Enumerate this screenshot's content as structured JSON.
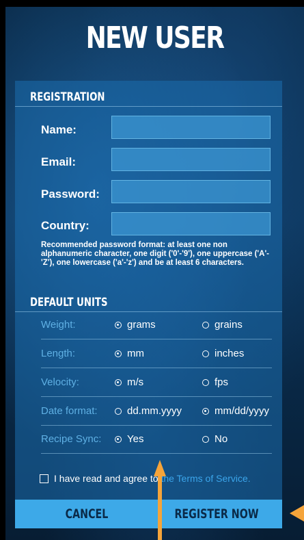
{
  "title": "NEW USER",
  "registration": {
    "heading": "REGISTRATION",
    "fields": [
      {
        "label": "Name:",
        "value": ""
      },
      {
        "label": "Email:",
        "value": ""
      },
      {
        "label": "Password:",
        "value": ""
      },
      {
        "label": "Country:",
        "value": ""
      }
    ],
    "hint": "Recommended password format: at least one non alphanumeric character, one digit ('0'-'9'), one uppercase ('A'-'Z'), one lowercase ('a'-'z') and be at least 6 characters."
  },
  "units": {
    "heading": "DEFAULT UNITS",
    "rows": [
      {
        "label": "Weight:",
        "option_a": "grams",
        "option_b": "grains",
        "selected": "a"
      },
      {
        "label": "Length:",
        "option_a": "mm",
        "option_b": "inches",
        "selected": "a"
      },
      {
        "label": "Velocity:",
        "option_a": "m/s",
        "option_b": "fps",
        "selected": "a"
      },
      {
        "label": "Date format:",
        "option_a": "dd.mm.yyyy",
        "option_b": "mm/dd/yyyy",
        "selected": "b"
      },
      {
        "label": "Recipe Sync:",
        "option_a": "Yes",
        "option_b": "No",
        "selected": "a"
      }
    ]
  },
  "terms": {
    "text": "I have read and agree to ",
    "link": "the Terms of Service.",
    "checked": false
  },
  "buttons": {
    "cancel": "CANCEL",
    "register": "REGISTER NOW"
  },
  "colors": {
    "accent": "#3da9e8",
    "arrow": "#f5a43a"
  }
}
